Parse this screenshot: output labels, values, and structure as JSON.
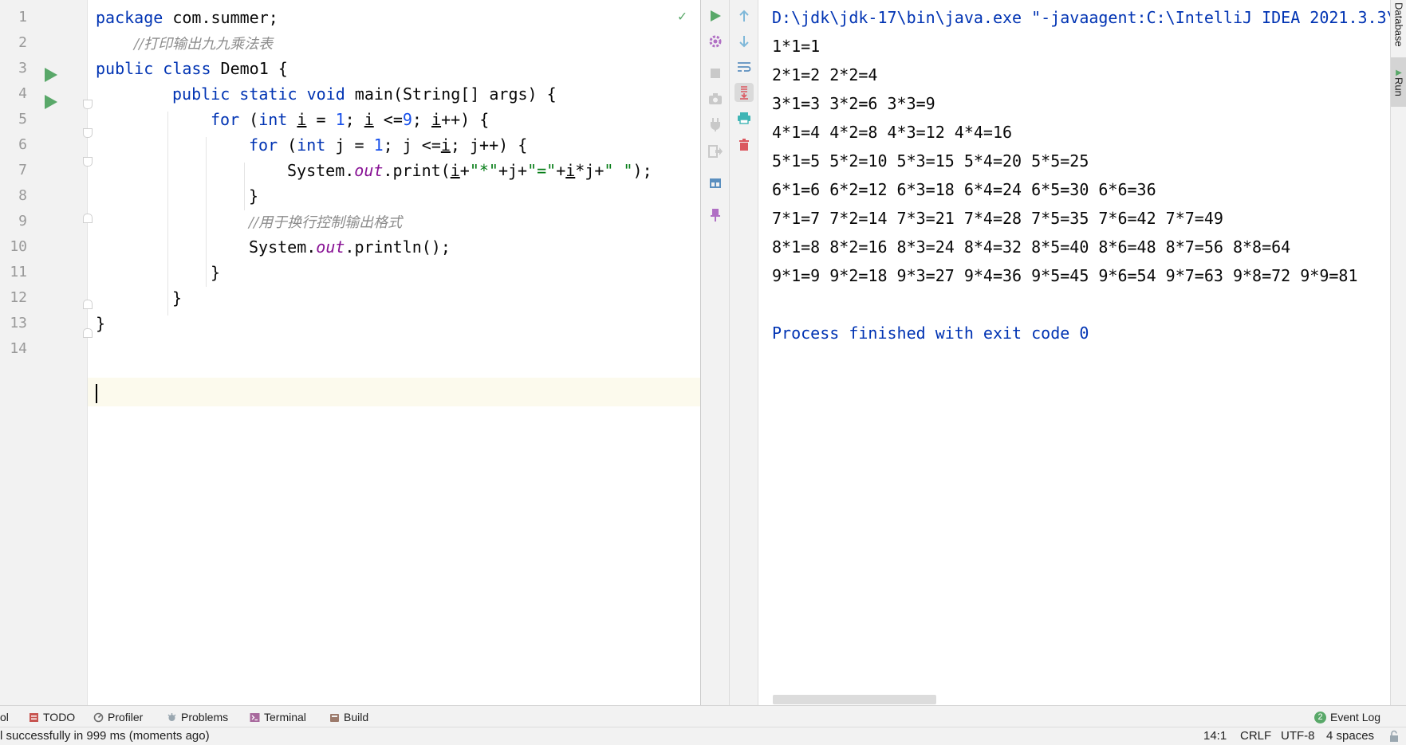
{
  "editor": {
    "line_numbers": [
      "1",
      "2",
      "3",
      "4",
      "5",
      "6",
      "7",
      "8",
      "9",
      "10",
      "11",
      "12",
      "13",
      "14"
    ],
    "code": {
      "l1_kw": "package",
      "l1_rest": " com.summer;",
      "l2_comment": "//打印输出九九乘法表",
      "l3_kw": "public class",
      "l3_rest": " Demo1 {",
      "l4_kw1": "public static void",
      "l4_rest": " main(String[] args) {",
      "l5_for": "for",
      "l5_open": " (",
      "l5_int": "int",
      "l5_sp": " ",
      "l5_i1": "i",
      "l5_eq": " = ",
      "l5_n1": "1",
      "l5_semi1": "; ",
      "l5_i2": "i",
      "l5_le": " <=",
      "l5_n9": "9",
      "l5_semi2": "; ",
      "l5_i3": "i",
      "l5_end": "++) {",
      "l6_for": "for",
      "l6_open": " (",
      "l6_int": "int",
      "l6_a": " j = ",
      "l6_n1": "1",
      "l6_b": "; j <=",
      "l6_i": "i",
      "l6_c": "; j++) {",
      "l7_sys": "System.",
      "l7_out": "out",
      "l7_print": ".print(",
      "l7_i1": "i",
      "l7_p1": "+",
      "l7_s1": "\"*\"",
      "l7_p2": "+j+",
      "l7_s2": "\"=\"",
      "l7_p3": "+",
      "l7_i2": "i",
      "l7_p4": "*j+",
      "l7_s3": "\" \"",
      "l7_end": ");",
      "l8": "}",
      "l9_comment": "//用于换行控制输出格式",
      "l10_sys": "System.",
      "l10_out": "out",
      "l10_rest": ".println();",
      "l11": "}",
      "l12": "}",
      "l13": "}"
    }
  },
  "console": {
    "command": "D:\\jdk\\jdk-17\\bin\\java.exe \"-javaagent:C:\\IntelliJ IDEA 2021.3.3\\",
    "lines": [
      "1*1=1",
      "2*1=2 2*2=4",
      "3*1=3 3*2=6 3*3=9",
      "4*1=4 4*2=8 4*3=12 4*4=16",
      "5*1=5 5*2=10 5*3=15 5*4=20 5*5=25",
      "6*1=6 6*2=12 6*3=18 6*4=24 6*5=30 6*6=36",
      "7*1=7 7*2=14 7*3=21 7*4=28 7*5=35 7*6=42 7*7=49",
      "8*1=8 8*2=16 8*3=24 8*4=32 8*5=40 8*6=48 8*7=56 8*8=64",
      "9*1=9 9*2=18 9*3=27 9*4=36 9*5=45 9*6=54 9*7=63 9*8=72 9*9=81"
    ],
    "finished": "Process finished with exit code 0"
  },
  "right_stripe": {
    "database": "Database",
    "run": "Run"
  },
  "tool_windows": {
    "partial": "ol",
    "todo": "TODO",
    "profiler": "Profiler",
    "problems": "Problems",
    "terminal": "Terminal",
    "build": "Build",
    "event_log": "Event Log",
    "event_count": "2"
  },
  "status_bar": {
    "message": "l successfully in 999 ms (moments ago)",
    "position": "14:1",
    "line_ending": "CRLF",
    "encoding": "UTF-8",
    "indent": "4 spaces"
  },
  "colors": {
    "keyword": "#0033b3",
    "number": "#1750eb",
    "string": "#067d17",
    "field": "#871094",
    "comment": "#8c8c8c",
    "run_green": "#59a869",
    "stop_red": "#db5860"
  },
  "icons": {
    "gutter": [
      "run-icon",
      "fold-icon"
    ],
    "run_toolbar": [
      "rerun-icon",
      "settings-icon",
      "stop-icon",
      "camera-icon",
      "attach-icon",
      "exit-icon",
      "layout-icon",
      "pin-icon",
      "up-arrow-icon",
      "down-arrow-icon",
      "soft-wrap-icon",
      "scroll-to-end-icon",
      "print-icon",
      "clear-icon"
    ]
  }
}
